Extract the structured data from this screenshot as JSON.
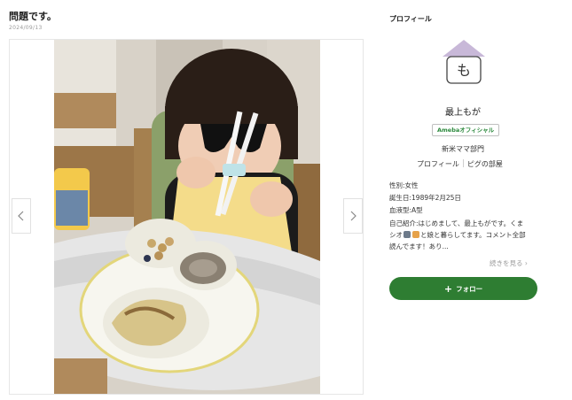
{
  "post": {
    "title": "問題です。",
    "date": "2024/09/13"
  },
  "gallery": {
    "photo_icon": "photo-child-eating",
    "prev_icon": "chevron-left-icon",
    "next_icon": "chevron-right-icon"
  },
  "sidebar": {
    "heading": "プロフィール",
    "avatar_letter": "も",
    "blogger_name": "最上もが",
    "badge": "Amebaオフィシャル",
    "category": "新米ママ部門",
    "links": [
      "プロフィール",
      "ピグの部屋"
    ],
    "gender": "性別:女性",
    "birthday": "誕生日:1989年2月25日",
    "blood_type": "血液型:A型",
    "bio_line1": "自己紹介:はじめまして、最上もがです。くま",
    "bio_line2_a": "シオ",
    "bio_line2_b": "と娘と暮らしてます。コメント全部",
    "bio_line3": "読んでます！あり...",
    "read_more": "続きを見る ›",
    "follow": "フォロー",
    "colors": {
      "follow_green": "#2e7d32",
      "avatar_roof": "#c8b8d8"
    }
  }
}
